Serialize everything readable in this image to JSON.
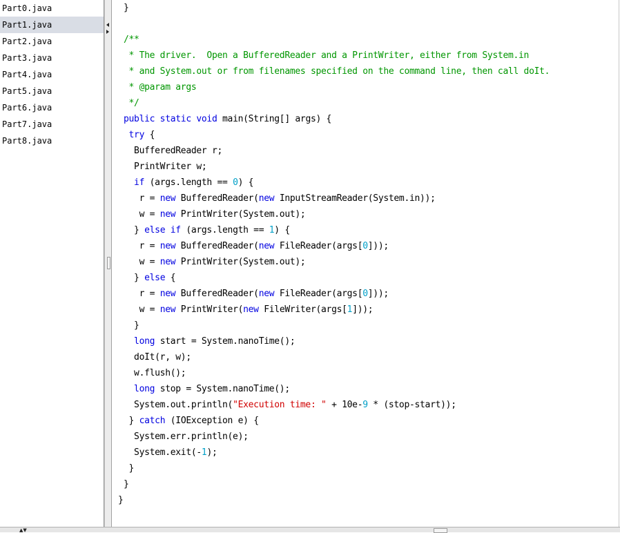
{
  "sidebar": {
    "files": [
      "Part0.java",
      "Part1.java",
      "Part2.java",
      "Part3.java",
      "Part4.java",
      "Part5.java",
      "Part6.java",
      "Part7.java",
      "Part8.java"
    ],
    "selected_index": 1
  },
  "colors": {
    "keyword": "#0000e0",
    "comment": "#009600",
    "string": "#d00000",
    "number": "#00a0c8",
    "selection": "#d9dde5"
  },
  "editor": {
    "lines": [
      [
        [
          "p",
          "}"
        ]
      ],
      [],
      [
        [
          "c",
          "/**"
        ]
      ],
      [
        [
          "c",
          " * The driver.  Open a BufferedReader and a PrintWriter, either from System.in"
        ]
      ],
      [
        [
          "c",
          " * and System.out or from filenames specified on the command line, then call doIt."
        ]
      ],
      [
        [
          "c",
          " * @param args"
        ]
      ],
      [
        [
          "c",
          " */"
        ]
      ],
      [
        [
          "k",
          "public static void "
        ],
        [
          "p",
          "main(String[] args) {"
        ]
      ],
      [
        [
          "k",
          " try "
        ],
        [
          "p",
          "{"
        ]
      ],
      [
        [
          "p",
          "  BufferedReader r;"
        ]
      ],
      [
        [
          "p",
          "  PrintWriter w;"
        ]
      ],
      [
        [
          "k",
          "  if "
        ],
        [
          "p",
          "(args.length == "
        ],
        [
          "n",
          "0"
        ],
        [
          "p",
          ") {"
        ]
      ],
      [
        [
          "p",
          "   r = "
        ],
        [
          "k",
          "new "
        ],
        [
          "p",
          "BufferedReader("
        ],
        [
          "k",
          "new "
        ],
        [
          "p",
          "InputStreamReader(System.in));"
        ]
      ],
      [
        [
          "p",
          "   w = "
        ],
        [
          "k",
          "new "
        ],
        [
          "p",
          "PrintWriter(System.out);"
        ]
      ],
      [
        [
          "p",
          "  } "
        ],
        [
          "k",
          "else if "
        ],
        [
          "p",
          "(args.length == "
        ],
        [
          "n",
          "1"
        ],
        [
          "p",
          ") {"
        ]
      ],
      [
        [
          "p",
          "   r = "
        ],
        [
          "k",
          "new "
        ],
        [
          "p",
          "BufferedReader("
        ],
        [
          "k",
          "new "
        ],
        [
          "p",
          "FileReader(args["
        ],
        [
          "n",
          "0"
        ],
        [
          "p",
          "]));"
        ]
      ],
      [
        [
          "p",
          "   w = "
        ],
        [
          "k",
          "new "
        ],
        [
          "p",
          "PrintWriter(System.out);"
        ]
      ],
      [
        [
          "p",
          "  } "
        ],
        [
          "k",
          "else "
        ],
        [
          "p",
          "{"
        ]
      ],
      [
        [
          "p",
          "   r = "
        ],
        [
          "k",
          "new "
        ],
        [
          "p",
          "BufferedReader("
        ],
        [
          "k",
          "new "
        ],
        [
          "p",
          "FileReader(args["
        ],
        [
          "n",
          "0"
        ],
        [
          "p",
          "]));"
        ]
      ],
      [
        [
          "p",
          "   w = "
        ],
        [
          "k",
          "new "
        ],
        [
          "p",
          "PrintWriter("
        ],
        [
          "k",
          "new "
        ],
        [
          "p",
          "FileWriter(args["
        ],
        [
          "n",
          "1"
        ],
        [
          "p",
          "]));"
        ]
      ],
      [
        [
          "p",
          "  }"
        ]
      ],
      [
        [
          "k",
          "  long "
        ],
        [
          "p",
          "start = System.nanoTime();"
        ]
      ],
      [
        [
          "p",
          "  doIt(r, w);"
        ]
      ],
      [
        [
          "p",
          "  w.flush();"
        ]
      ],
      [
        [
          "k",
          "  long "
        ],
        [
          "p",
          "stop = System.nanoTime();"
        ]
      ],
      [
        [
          "p",
          "  System.out.println("
        ],
        [
          "s",
          "\"Execution time: \""
        ],
        [
          "p",
          " + 10e-"
        ],
        [
          "n",
          "9"
        ],
        [
          "p",
          " * (stop-start));"
        ]
      ],
      [
        [
          "p",
          " } "
        ],
        [
          "k",
          "catch "
        ],
        [
          "p",
          "(IOException e) {"
        ]
      ],
      [
        [
          "p",
          "  System.err.println(e);"
        ]
      ],
      [
        [
          "p",
          "  System.exit(-"
        ],
        [
          "n",
          "1"
        ],
        [
          "p",
          ");"
        ]
      ],
      [
        [
          "p",
          " }"
        ]
      ],
      [
        [
          "p",
          "}"
        ]
      ],
      [
        [
          "p",
          "}"
        ]
      ]
    ],
    "indents": [
      0,
      0,
      0,
      0,
      0,
      0,
      0,
      0,
      0,
      0,
      0,
      0,
      0,
      0,
      0,
      0,
      0,
      0,
      0,
      0,
      0,
      0,
      0,
      0,
      0,
      0,
      0,
      0,
      0,
      0,
      0,
      -1
    ]
  }
}
